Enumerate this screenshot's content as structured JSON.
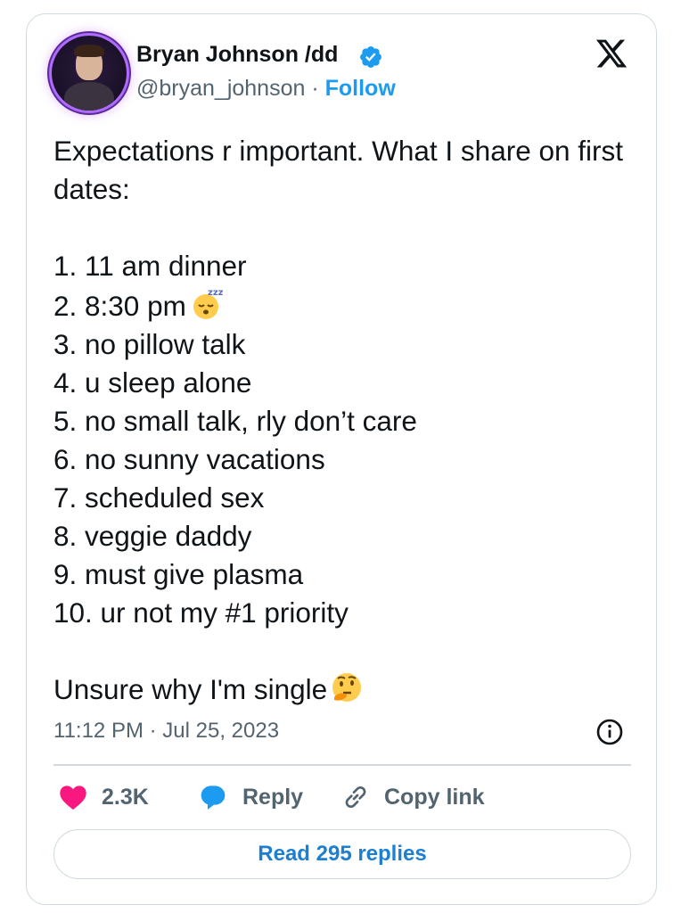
{
  "author": {
    "name": "Bryan Johnson /dd",
    "handle": "@bryan_johnson",
    "separator": " · ",
    "follow_label": "Follow",
    "verified": true
  },
  "tweet": {
    "intro": "Expectations r important. What I share on first dates:",
    "list": [
      "1. 11 am dinner",
      "2. 8:30 pm",
      "3. no pillow talk",
      "4. u sleep alone",
      "5. no small talk, rly don’t care",
      "6. no sunny vacations",
      "7. scheduled sex",
      "8. veggie daddy",
      "9. must give plasma",
      "10. ur not my #1 priority"
    ],
    "closing": "Unsure why I'm single",
    "emojis": {
      "after_item_2": "sleeping-face-emoji",
      "after_closing": "thinking-face-emoji"
    },
    "timestamp": "11:12 PM · Jul 25, 2023"
  },
  "actions": {
    "like_count": "2.3K",
    "reply_label": "Reply",
    "copy_label": "Copy link",
    "read_replies_label": "Read 295 replies"
  },
  "colors": {
    "accent": "#1d9bf0",
    "like": "#f91880",
    "text": "#0f1419",
    "muted": "#536471",
    "border": "#cfd9de"
  }
}
